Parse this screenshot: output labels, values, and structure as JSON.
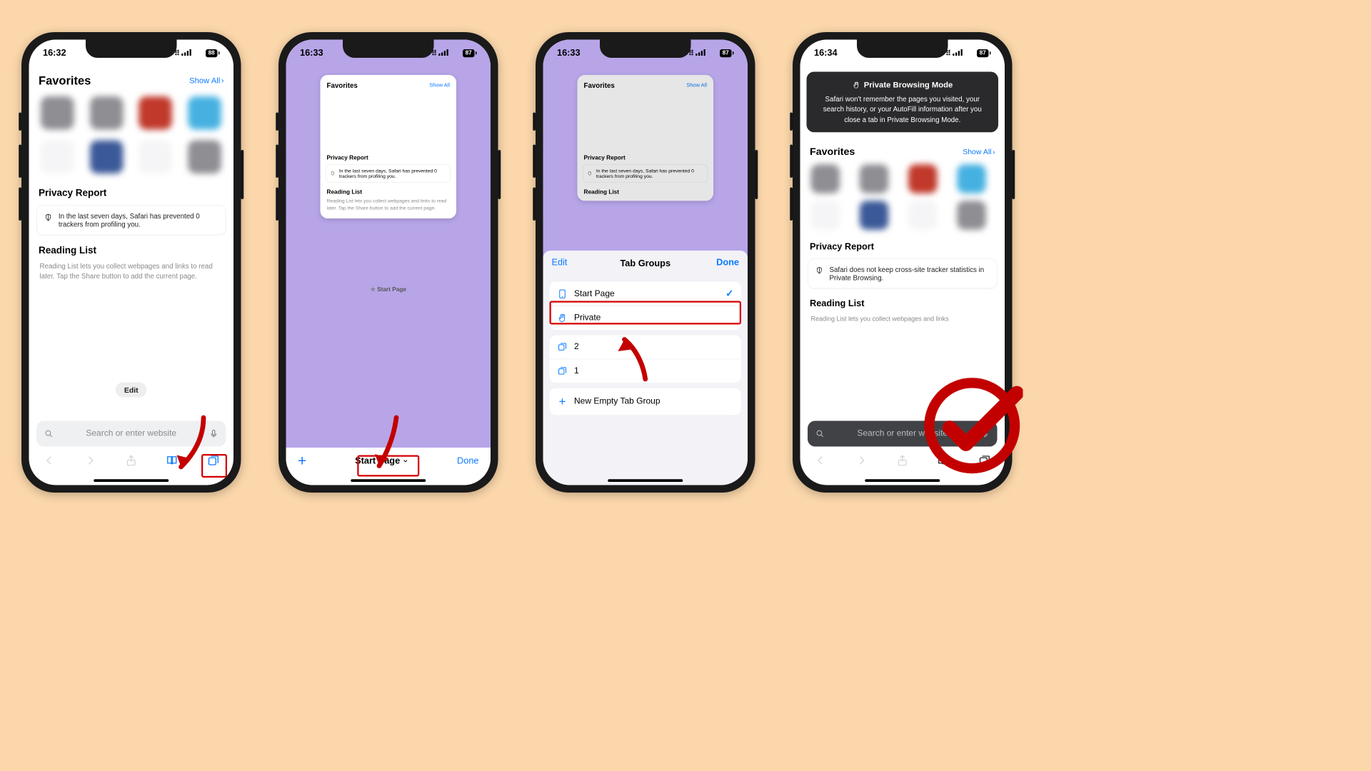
{
  "phones": [
    {
      "time": "16:32",
      "battery": "88"
    },
    {
      "time": "16:33",
      "battery": "87"
    },
    {
      "time": "16:33",
      "battery": "87"
    },
    {
      "time": "16:34",
      "battery": "87"
    }
  ],
  "common": {
    "favorites_title": "Favorites",
    "show_all": "Show All",
    "privacy_title": "Privacy Report",
    "privacy_text": "In the last seven days, Safari has prevented 0 trackers from profiling you.",
    "reading_title": "Reading List",
    "reading_text": "Reading List lets you collect webpages and links to read later. Tap the Share button to add the current page.",
    "edit": "Edit",
    "search_ph": "Search or enter website"
  },
  "p2": {
    "caption": "Start Page",
    "mid": "Start Page",
    "new_tab": "+",
    "done": "Done"
  },
  "p3": {
    "sheet_title": "Tab Groups",
    "edit": "Edit",
    "done": "Done",
    "start_page": "Start Page",
    "private": "Private",
    "g1": "2",
    "g2": "1",
    "new_group": "New Empty Tab Group"
  },
  "p4": {
    "banner_title": "Private Browsing Mode",
    "banner_text": "Safari won't remember the pages you visited, your search history, or your AutoFill information after you close a tab in Private Browsing Mode.",
    "privacy_text": "Safari does not keep cross-site tracker statistics in Private Browsing.",
    "reading_text": "Reading List lets you collect webpages and links"
  }
}
